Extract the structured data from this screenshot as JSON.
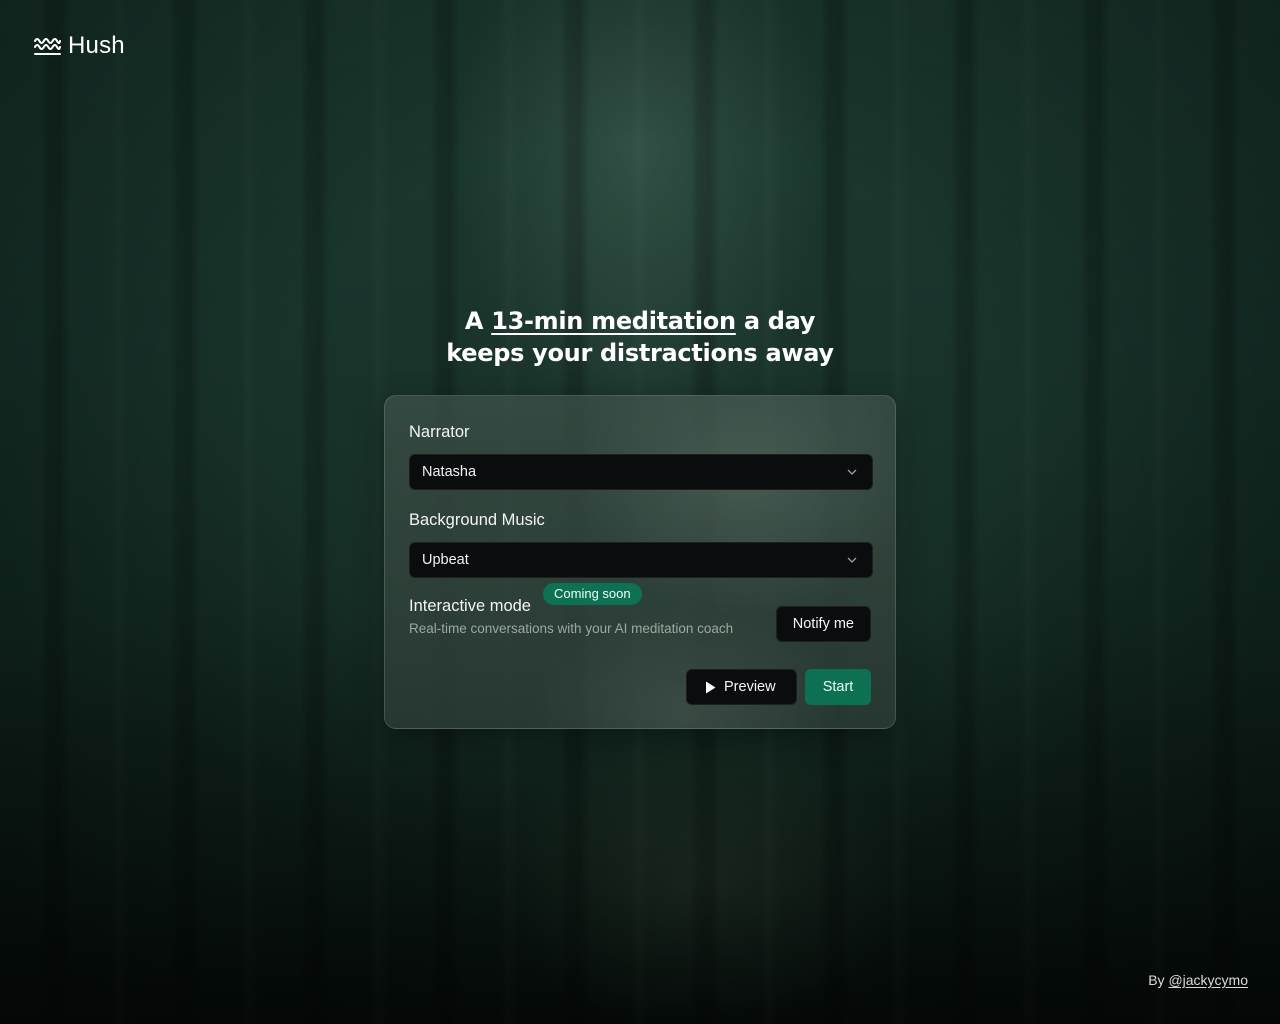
{
  "brand": {
    "name": "Hush",
    "icon": "waves-icon"
  },
  "hero": {
    "prefix": "A ",
    "highlight": "13-min meditation",
    "suffix": " a day",
    "line2": "keeps your distractions away"
  },
  "form": {
    "narrator": {
      "label": "Narrator",
      "value": "Natasha",
      "icon": "chevron-down-icon"
    },
    "music": {
      "label": "Background Music",
      "value": "Upbeat",
      "icon": "chevron-down-icon"
    },
    "interactive": {
      "title": "Interactive mode",
      "badge": "Coming soon",
      "description": "Real-time conversations with your AI meditation coach",
      "notify_label": "Notify me"
    },
    "actions": {
      "preview_label": "Preview",
      "preview_icon": "play-icon",
      "start_label": "Start"
    }
  },
  "footer": {
    "by_prefix": "By ",
    "author": "@jackycymo"
  },
  "colors": {
    "accent": "#0d7052",
    "badge": "#0e7153",
    "control_bg": "#0b0c0e"
  }
}
